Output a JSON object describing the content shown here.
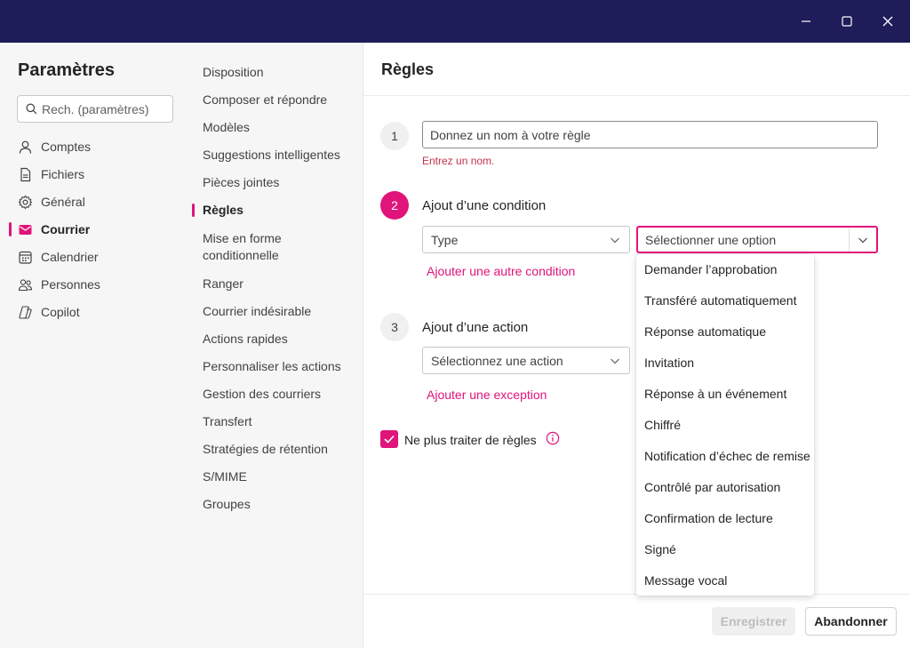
{
  "window": {
    "controls": {
      "minimize": "minimize-icon",
      "maximize": "maximize-icon",
      "close": "close-icon"
    }
  },
  "sidebar": {
    "title": "Paramètres",
    "search_placeholder": "Rech. (paramètres)",
    "items": [
      {
        "label": "Comptes",
        "icon": "person-icon"
      },
      {
        "label": "Fichiers",
        "icon": "file-icon"
      },
      {
        "label": "Général",
        "icon": "gear-icon"
      },
      {
        "label": "Courrier",
        "icon": "mail-icon",
        "active": true
      },
      {
        "label": "Calendrier",
        "icon": "calendar-icon"
      },
      {
        "label": "Personnes",
        "icon": "people-icon"
      },
      {
        "label": "Copilot",
        "icon": "copilot-icon"
      }
    ]
  },
  "subnav": {
    "items": [
      "Disposition",
      "Composer et répondre",
      "Modèles",
      "Suggestions intelligentes",
      "Pièces jointes",
      "Règles",
      "Mise en forme conditionnelle",
      "Ranger",
      "Courrier indésirable",
      "Actions rapides",
      "Personnaliser les actions",
      "Gestion des courriers",
      "Transfert",
      "Stratégies de rétention",
      "S/MIME",
      "Groupes"
    ],
    "active": "Règles"
  },
  "rules": {
    "title": "Règles",
    "step1": {
      "number": "1",
      "placeholder": "Donnez un nom à votre règle",
      "error": "Entrez un nom."
    },
    "step2": {
      "number": "2",
      "label": "Ajout d’une condition",
      "type_select": "Type",
      "option_select": "Sélectionner une option",
      "add_link": "Ajouter une autre condition"
    },
    "step3": {
      "number": "3",
      "label": "Ajout d’une action",
      "action_select": "Sélectionnez une action",
      "exception_link": "Ajouter une exception"
    },
    "stop_processing": "Ne plus traiter de règles",
    "dropdown_options": [
      "Demander l’approbation",
      "Transféré automatiquement",
      "Réponse automatique",
      "Invitation",
      "Réponse à un événement",
      "Chiffré",
      "Notification d’échec de remise",
      "Contrôlé par autorisation",
      "Confirmation de lecture",
      "Signé",
      "Message vocal"
    ],
    "save_label": "Enregistrer",
    "cancel_label": "Abandonner"
  },
  "colors": {
    "accent": "#e0147a",
    "titlebar": "#1f1c5a",
    "error": "#c4314b"
  }
}
